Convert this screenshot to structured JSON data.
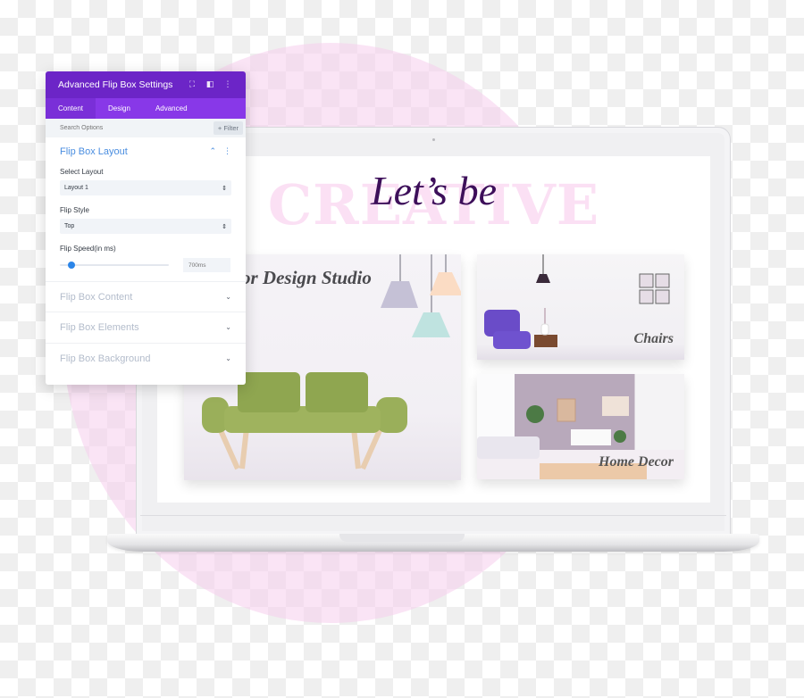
{
  "colors": {
    "panel_header": "#6c25c7",
    "panel_tabs": "#8838e8",
    "section_active": "#4a8ee0",
    "section_inactive": "#b3bccb",
    "slider_thumb": "#2c85e8",
    "heading_purple": "#3d0f5a",
    "creative_pink": "#fbe0f4"
  },
  "panel": {
    "title": "Advanced Flip Box Settings",
    "header_icons": [
      "fullscreen-icon",
      "sidebar-layout-icon",
      "more-vertical-icon"
    ],
    "tabs": [
      {
        "label": "Content",
        "active": true
      },
      {
        "label": "Design",
        "active": false
      },
      {
        "label": "Advanced",
        "active": false
      }
    ],
    "search": {
      "placeholder": "Search Options",
      "value": ""
    },
    "filter_label": "+ Filter",
    "open_section": {
      "title": "Flip Box Layout",
      "fields": {
        "select_layout": {
          "label": "Select Layout",
          "value": "Layout 1"
        },
        "flip_style": {
          "label": "Flip Style",
          "value": "Top"
        },
        "flip_speed": {
          "label": "Flip Speed(in ms)",
          "placeholder": "700ms",
          "slider_fraction": 0.08
        }
      }
    },
    "closed_sections": [
      {
        "title": "Flip Box Content"
      },
      {
        "title": "Flip Box Elements"
      },
      {
        "title": "Flip Box Background"
      }
    ]
  },
  "preview": {
    "background_word": "CREATIVE",
    "heading": "Let’s be",
    "cards": [
      {
        "title": "or Design Studio"
      },
      {
        "title": "Chairs"
      },
      {
        "title": "Home Decor"
      }
    ]
  }
}
